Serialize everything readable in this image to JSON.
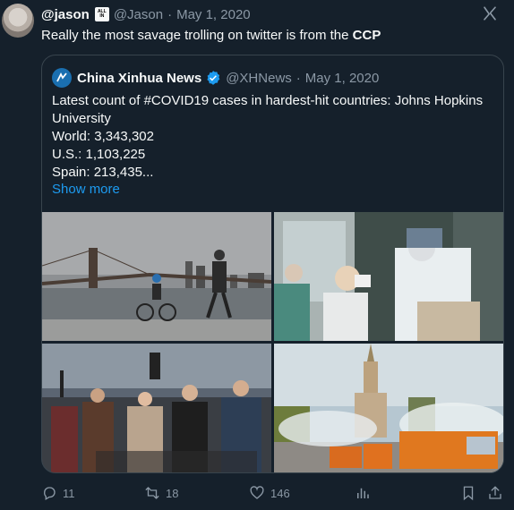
{
  "tweet": {
    "author_name": "@jason",
    "badge_text": "ALL IN",
    "handle": "@Jason",
    "separator": "·",
    "date": "May 1, 2020",
    "text_main": "Really the most savage trolling on twitter is from the ",
    "text_bold": "CCP"
  },
  "quote": {
    "author_name": "China Xinhua News",
    "handle": "@XHNews",
    "separator": "·",
    "date": "May 1, 2020",
    "lines": [
      "Latest count of #COVID19 cases in hardest-hit countries: Johns Hopkins University",
      "World: 3,343,302",
      "U.S.: 1,103,225",
      "Spain: 213,435..."
    ],
    "show_more": "Show more"
  },
  "actions": {
    "reply_count": "11",
    "retweet_count": "18",
    "like_count": "146"
  },
  "colors": {
    "background": "#15202b",
    "text": "#f7f9f9",
    "muted": "#8b98a5",
    "link": "#1d9bf0",
    "border": "#38444d",
    "verified": "#1d9bf0"
  },
  "icons": [
    "grok-icon",
    "verified-badge-icon",
    "reply-icon",
    "retweet-icon",
    "like-icon",
    "views-icon",
    "bookmark-icon",
    "share-icon"
  ]
}
